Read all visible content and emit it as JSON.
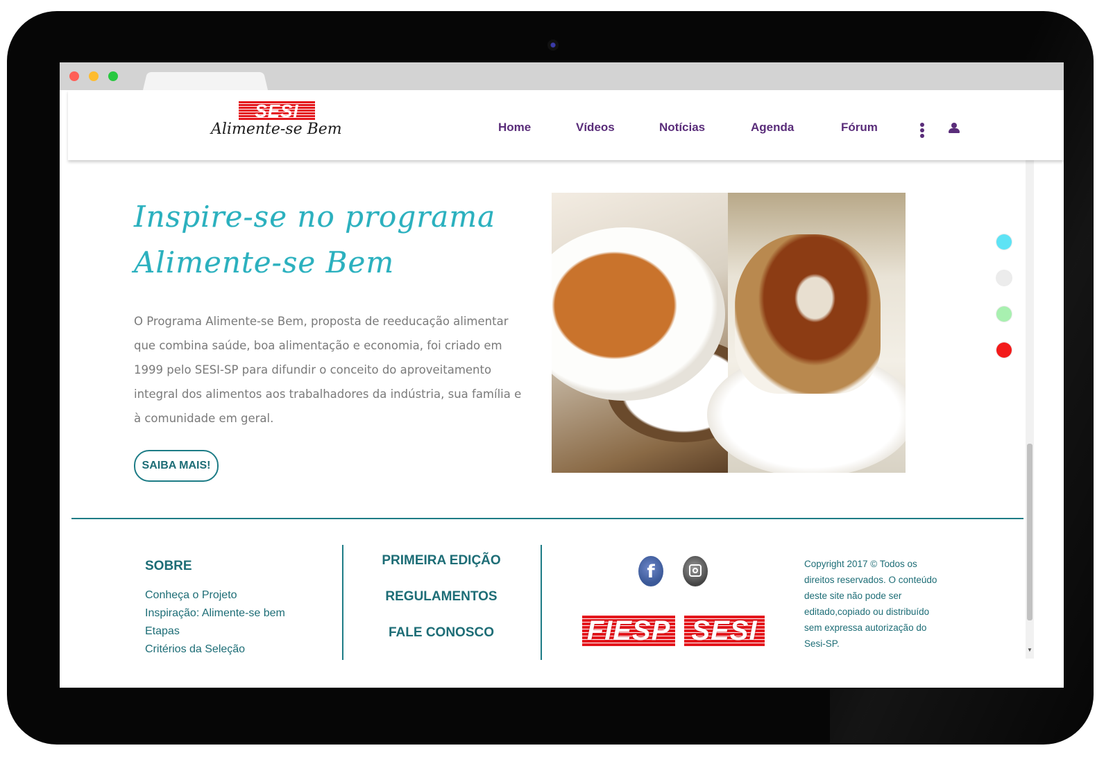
{
  "header": {
    "logo_badge": "SESI",
    "logo_script": "Alimente-se Bem",
    "nav": [
      "Home",
      "Vídeos",
      "Notícias",
      "Agenda",
      "Fórum"
    ]
  },
  "hero": {
    "title_line1": "Inspire-se no programa",
    "title_line2": "Alimente-se Bem",
    "text": "O Programa Alimente-se Bem, proposta de reeducação alimentar que combina saúde, boa alimentação e economia, foi criado em 1999 pelo SESI-SP para difundir o conceito do aproveitamento integral dos alimentos aos trabalhadores da indústria, sua família e à comunidade em geral.",
    "button": "SAIBA MAIS!"
  },
  "color_options": [
    "#5ee3f5",
    "#ececec",
    "#a8f0b0",
    "#f31a1a"
  ],
  "footer": {
    "sobre_title": "SOBRE",
    "sobre_links": [
      "Conheça o Projeto",
      "Inspiração: Alimente-se bem",
      "Etapas",
      "Critérios da Seleção"
    ],
    "middle_links": [
      "PRIMEIRA EDIÇÃO",
      "REGULAMENTOS",
      "FALE CONOSCO"
    ],
    "social_icons": [
      "facebook-icon",
      "instagram-icon"
    ],
    "facebook_glyph": "f",
    "brands": [
      "FIESP",
      "SESI"
    ],
    "copyright": "Copyright 2017 © Todos os direitos reservados. O conteúdo deste site não pode ser editado,copiado ou distribuído sem expressa autorização do Sesi-SP."
  },
  "colors": {
    "nav": "#5a2d7a",
    "accent": "#1d7c86",
    "title": "#2bb0be",
    "brand_red": "#e4161c"
  }
}
